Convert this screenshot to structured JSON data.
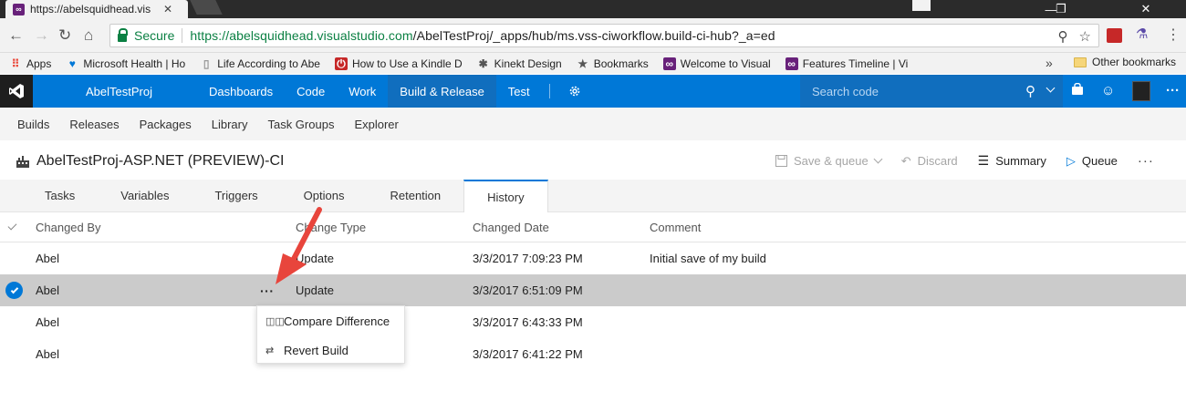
{
  "browser": {
    "tab_title": "https://abelsquidhead.vis",
    "tab_close": "✕",
    "window_controls": [
      "—",
      "❐",
      "✕"
    ],
    "secure_label": "Secure",
    "url_scheme": "https://",
    "url_host": "abelsquidhead.visualstudio.com",
    "url_path": "/AbelTestProj/_apps/hub/ms.vss-ciworkflow.build-ci-hub?_a=ed",
    "bookmarks": [
      {
        "label": "Apps",
        "icon": "apps-grid-icon",
        "color": "#ea4335"
      },
      {
        "label": "Microsoft Health | Ho",
        "icon": "health-heart-icon",
        "color": "#0078d7"
      },
      {
        "label": "Life According to Abe",
        "icon": "page-icon",
        "color": "#999999"
      },
      {
        "label": "How to Use a Kindle D",
        "icon": "power-icon",
        "color": "#c62828"
      },
      {
        "label": "Kinekt Design",
        "icon": "kinekt-icon",
        "color": "#555555"
      },
      {
        "label": "Bookmarks",
        "icon": "star-icon",
        "color": "#555555"
      },
      {
        "label": "Welcome to Visual",
        "icon": "vs-icon",
        "color": "#68217a"
      },
      {
        "label": "Features Timeline | Vi",
        "icon": "vs-icon",
        "color": "#68217a"
      }
    ],
    "bookmarks_more": "»",
    "other_bookmarks": "Other bookmarks"
  },
  "header": {
    "project": "AbelTestProj",
    "nav": [
      {
        "label": "Dashboards",
        "active": false
      },
      {
        "label": "Code",
        "active": false
      },
      {
        "label": "Work",
        "active": false
      },
      {
        "label": "Build & Release",
        "active": true
      },
      {
        "label": "Test",
        "active": false
      }
    ],
    "search_placeholder": "Search code"
  },
  "subnav": [
    "Builds",
    "Releases",
    "Packages",
    "Library",
    "Task Groups",
    "Explorer"
  ],
  "definition": {
    "title": "AbelTestProj-ASP.NET (PREVIEW)-CI",
    "save_queue": "Save & queue",
    "discard": "Discard",
    "summary": "Summary",
    "queue": "Queue",
    "more": "···"
  },
  "editor_tabs": [
    {
      "label": "Tasks",
      "active": false
    },
    {
      "label": "Variables",
      "active": false
    },
    {
      "label": "Triggers",
      "active": false
    },
    {
      "label": "Options",
      "active": false
    },
    {
      "label": "Retention",
      "active": false
    },
    {
      "label": "History",
      "active": true
    }
  ],
  "history": {
    "columns": {
      "changed_by": "Changed By",
      "change_type": "Change Type",
      "changed_date": "Changed Date",
      "comment": "Comment"
    },
    "rows": [
      {
        "changed_by": "Abel",
        "change_type": "Update",
        "changed_date": "3/3/2017 7:09:23 PM",
        "comment": "Initial save of my build",
        "selected": false
      },
      {
        "changed_by": "Abel",
        "change_type": "Update",
        "changed_date": "3/3/2017 6:51:09 PM",
        "comment": "",
        "selected": true
      },
      {
        "changed_by": "Abel",
        "change_type": "",
        "changed_date": "3/3/2017 6:43:33 PM",
        "comment": "",
        "selected": false
      },
      {
        "changed_by": "Abel",
        "change_type": "",
        "changed_date": "3/3/2017 6:41:22 PM",
        "comment": "",
        "selected": false
      }
    ],
    "row_more": "···"
  },
  "context_menu": [
    {
      "label": "Compare Difference",
      "icon": "compare-icon"
    },
    {
      "label": "Revert Build",
      "icon": "revert-icon"
    }
  ],
  "colors": {
    "accent": "#0078d7",
    "selected_row": "#cbcbcb",
    "annotation_arrow": "#e8453c"
  }
}
